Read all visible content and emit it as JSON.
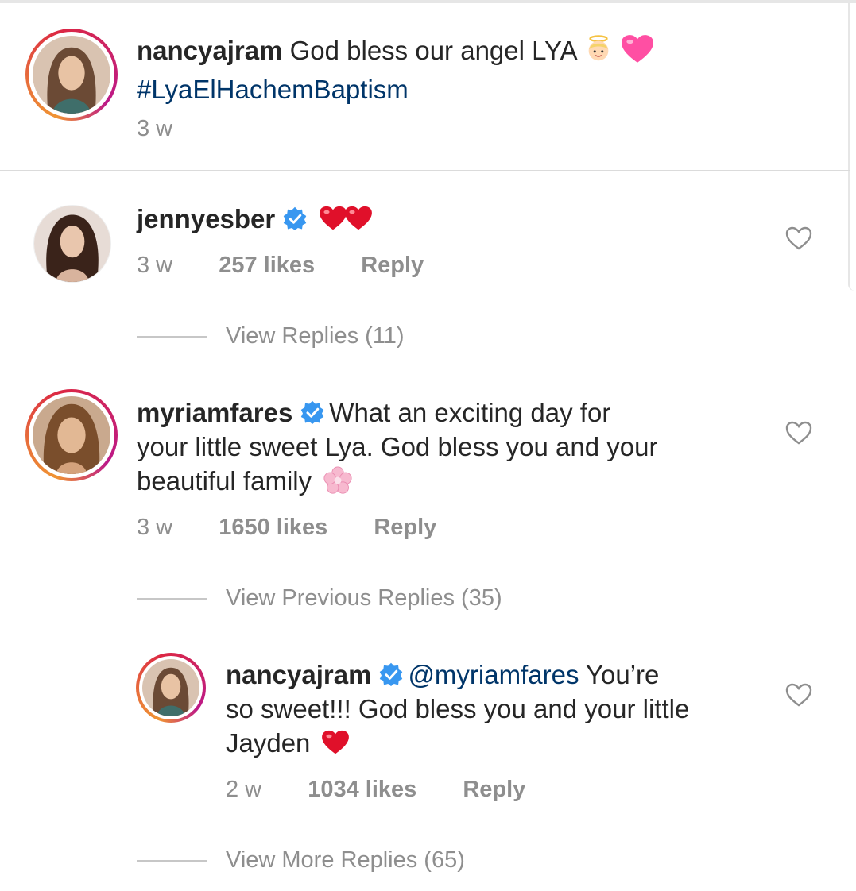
{
  "caption": {
    "username": "nancyajram",
    "text": " God bless our angel LYA",
    "hashtag": "#LyaElHachemBaptism",
    "time": "3 w"
  },
  "comments": [
    {
      "username": "jennyesber",
      "verified": true,
      "text": "",
      "time": "3 w",
      "likes": "257 likes",
      "reply": "Reply",
      "view_replies": "View Replies (11)"
    },
    {
      "username": "myriamfares",
      "verified": true,
      "text_line1": "What an exciting day for",
      "text_line2": "your little sweet Lya. God bless you and your",
      "text_line3": "beautiful family",
      "time": "3 w",
      "likes": "1650 likes",
      "reply": "Reply",
      "view_replies": "View Previous Replies (35)"
    }
  ],
  "reply": {
    "username": "nancyajram",
    "verified": true,
    "mention": "@myriamfares",
    "text_line1": " You’re",
    "text_line2": "so sweet!!! God bless you and your little",
    "text_line3": "Jayden",
    "time": "2 w",
    "likes": "1034 likes",
    "reply": "Reply",
    "view_replies": "View More Replies (65)"
  },
  "colors": {
    "link": "#003569",
    "muted": "#8e8e8e",
    "verified": "#3897f0",
    "heart": "#e0102a"
  }
}
